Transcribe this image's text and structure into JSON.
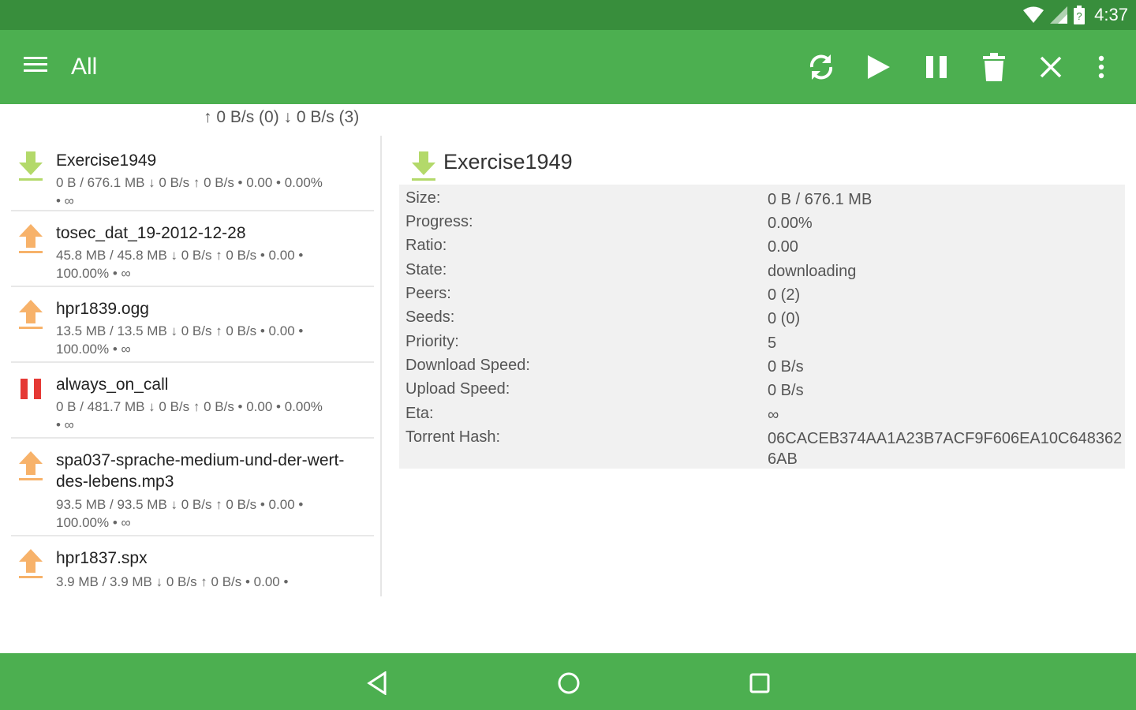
{
  "status_bar": {
    "time": "4:37",
    "icons": [
      "wifi-icon",
      "cell-signal-icon",
      "battery-icon"
    ]
  },
  "app_bar": {
    "title": "All",
    "actions": [
      "refresh-icon",
      "play-icon",
      "pause-icon",
      "trash-icon",
      "close-icon",
      "more-vert-icon"
    ]
  },
  "speed_summary": "↑ 0 B/s (0) ↓ 0 B/s (3)",
  "torrents": [
    {
      "name": "Exercise1949",
      "line1": "0 B / 676.1 MB ↓ 0 B/s ↑ 0 B/s • 0.00 • 0.00%",
      "line2": "• ∞",
      "status": "downloading"
    },
    {
      "name": "tosec_dat_19-2012-12-28",
      "line1": "45.8 MB / 45.8 MB ↓ 0 B/s ↑ 0 B/s • 0.00 •",
      "line2": "100.00% • ∞",
      "status": "seeding"
    },
    {
      "name": "hpr1839.ogg",
      "line1": "13.5 MB / 13.5 MB ↓ 0 B/s ↑ 0 B/s • 0.00 •",
      "line2": "100.00% • ∞",
      "status": "seeding"
    },
    {
      "name": "always_on_call",
      "line1": "0 B / 481.7 MB ↓ 0 B/s ↑ 0 B/s • 0.00 • 0.00%",
      "line2": "• ∞",
      "status": "paused"
    },
    {
      "name": "spa037-sprache-medium-und-der-wert-des-lebens.mp3",
      "line1": "93.5 MB / 93.5 MB ↓ 0 B/s ↑ 0 B/s • 0.00 •",
      "line2": "100.00% • ∞",
      "status": "seeding"
    },
    {
      "name": "hpr1837.spx",
      "line1": "3.9 MB / 3.9 MB ↓ 0 B/s ↑ 0 B/s • 0.00 •",
      "line2": "",
      "status": "seeding"
    }
  ],
  "detail": {
    "title": "Exercise1949",
    "rows": [
      {
        "label": "Size:",
        "value": "0 B / 676.1 MB"
      },
      {
        "label": "Progress:",
        "value": "0.00%"
      },
      {
        "label": "Ratio:",
        "value": "0.00"
      },
      {
        "label": "State:",
        "value": "downloading"
      },
      {
        "label": "Peers:",
        "value": "0 (2)"
      },
      {
        "label": "Seeds:",
        "value": "0 (0)"
      },
      {
        "label": "Priority:",
        "value": "5"
      },
      {
        "label": "Download Speed:",
        "value": "0 B/s"
      },
      {
        "label": "Upload Speed:",
        "value": "0 B/s"
      },
      {
        "label": "Eta:",
        "value": "∞"
      },
      {
        "label": "Torrent Hash:",
        "value": "06CACEB374AA1A23B7ACF9F606EA10C6483626AB"
      }
    ]
  },
  "nav_bar": {
    "buttons": [
      "back-icon",
      "home-icon",
      "recents-icon"
    ]
  },
  "colors": {
    "status_bar": "#388e3c",
    "app_bar": "#4caf50",
    "download_icon": "#b3d96a",
    "upload_icon": "#f7b26a",
    "pause_icon": "#e53935"
  }
}
